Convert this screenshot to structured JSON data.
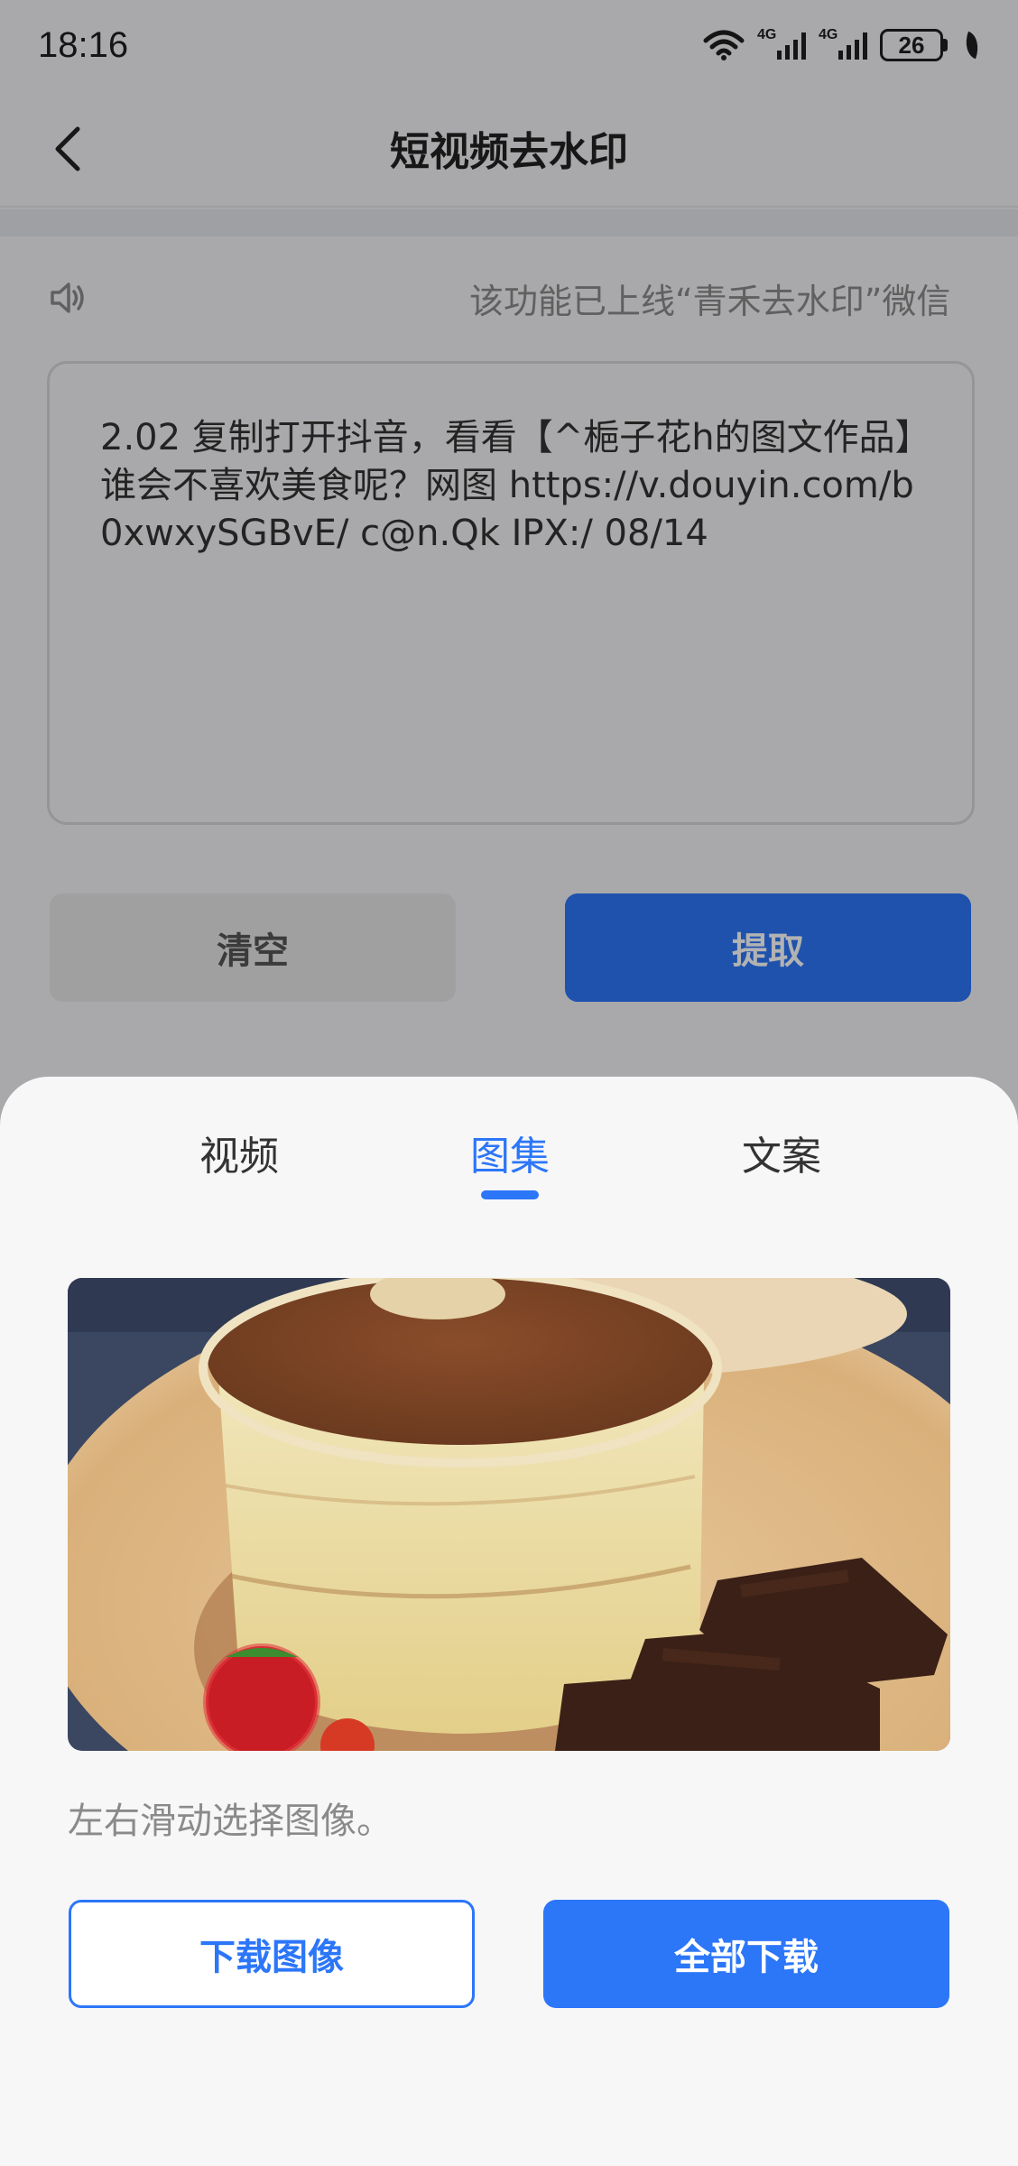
{
  "status_bar": {
    "time": "18:16",
    "wifi_icon": "wifi-icon",
    "signal_1_label": "4G",
    "signal_2_label": "4G",
    "battery_level": "26",
    "leaf_icon": "eco-leaf-icon"
  },
  "header": {
    "title": "短视频去水印",
    "back_icon": "chevron-left-icon"
  },
  "notice": {
    "icon": "speaker-icon",
    "text": "该功能已上线“青禾去水印”微信"
  },
  "input": {
    "value": "2.02 复制打开抖音，看看【^梔子花h的图文作品】谁会不喜欢美食呢？网图 https://v.douyin.com/b0xwxySGBvE/ c@n.Qk IPX:/ 08/14"
  },
  "actions": {
    "clear_label": "清空",
    "extract_label": "提取"
  },
  "sheet": {
    "tabs": [
      {
        "label": "视频",
        "active": false
      },
      {
        "label": "图集",
        "active": true
      },
      {
        "label": "文案",
        "active": false
      }
    ],
    "hint": "左右滑动选择图像。",
    "download_label": "下载图像",
    "download_all_label": "全部下载"
  },
  "colors": {
    "accent": "#2c76f8",
    "clear_button": "#e5e5e5",
    "sheet_bg": "#f7f7f8"
  }
}
